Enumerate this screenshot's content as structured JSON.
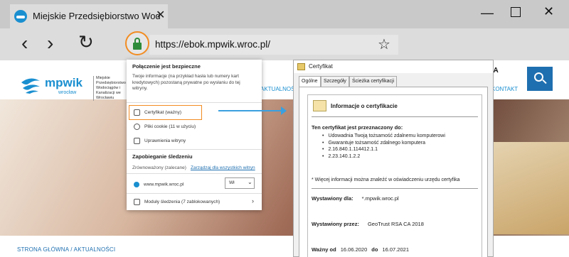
{
  "browser": {
    "tab_title": "Miejskie Przedsiębiorstwo Wod",
    "url": "https://ebok.mpwik.wroc.pl/"
  },
  "site": {
    "logo_name": "mpwik",
    "logo_city": "wrocław",
    "logo_desc": "Miejskie Przedsiębiorstwo Wodociągów i Kanalizacji we Wrocławiu",
    "menu_news": "AKTUALNOŚCI",
    "menu_contact": "KONTAKT",
    "font_size_controls": "A A A",
    "breadcrumb": "STRONA GŁÓWNA / AKTUALNOŚCI"
  },
  "popup": {
    "title": "Połączenie jest bezpieczne",
    "description": "Twoje informacje (na przykład hasła lub numery kart kredytowych) pozostaną prywatne po wysłaniu do tej witryny.",
    "cert_label": "Certyfikat (ważny)",
    "cookies_label": "Pliki cookie (11 w użyciu)",
    "permissions_label": "Uprawnienia witryny",
    "tracking_title": "Zapobieganie śledzeniu",
    "tracking_mode": "Zrównoważony (zalecane)",
    "tracking_link": "Zarządzaj dla wszystkich witryn",
    "site_label": "www.mpwik.wroc.pl",
    "site_select": "Wł",
    "modules_label": "Moduły śledzenia (7 zablokowanych)"
  },
  "certificate": {
    "window_title": "Certyfikat",
    "tabs": [
      "Ogólne",
      "Szczegóły",
      "Ścieżka certyfikacji"
    ],
    "info_title": "Informacje o certyfikacie",
    "purpose_title": "Ten certyfikat jest przeznaczony do:",
    "purposes": [
      "Udowadnia Twoją tożsamość zdalnemu komputerowi",
      "Gwarantuje tożsamość zdalnego komputera",
      "2.16.840.1.114412.1.1",
      "2.23.140.1.2.2"
    ],
    "note": "* Więcej informacji można znaleźć w oświadczeniu urzędu certyfika",
    "issued_to_label": "Wystawiony dla:",
    "issued_to_value": "*.mpwik.wroc.pl",
    "issued_by_label": "Wystawiony przez:",
    "issued_by_value": "GeoTrust RSA CA 2018",
    "valid_from_label": "Ważny od",
    "valid_from": "16.06.2020",
    "valid_to_label": "do",
    "valid_to": "16.07.2021"
  },
  "colors": {
    "accent": "#1a8fd0",
    "highlight": "#f28c22",
    "lock": "#2e8b3a"
  }
}
